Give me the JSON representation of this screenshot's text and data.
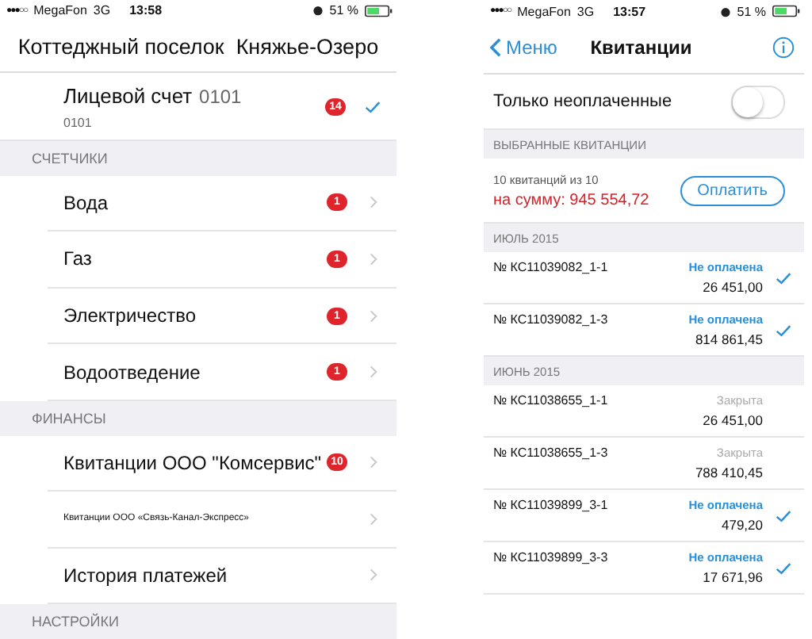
{
  "left_phone": {
    "status_bar": {
      "signal": "●●●○○",
      "carrier": "MegaFon",
      "network": "3G",
      "time": "13:58",
      "battery": "51 %"
    },
    "title": "Коттеджный поселок  Княжье-Озеро",
    "account": {
      "label": "Лицевой счет",
      "number": "0101",
      "subtitle": "0101",
      "badge": "14",
      "checked": true
    },
    "sections": [
      {
        "header": "СЧЕТЧИКИ",
        "items": [
          {
            "label": "Вода",
            "badge": "1",
            "small": false
          },
          {
            "label": "Газ",
            "badge": "1",
            "small": false
          },
          {
            "label": "Электричество",
            "badge": "1",
            "small": false
          },
          {
            "label": "Водоотведение",
            "badge": "1",
            "small": false
          }
        ]
      },
      {
        "header": "ФИНАНСЫ",
        "items": [
          {
            "label": "Квитанции ООО \"Комсервис\"",
            "badge": "10",
            "small": false
          },
          {
            "label": "Квитанции ООО «Связь-Канал-Экспресс»",
            "small": true
          },
          {
            "label": "История платежей",
            "small": false
          }
        ]
      },
      {
        "header": "НАСТРОЙКИ"
      }
    ]
  },
  "right_phone": {
    "status_bar": {
      "signal": "●●●○○",
      "carrier": "MegaFon",
      "network": "3G",
      "time": "13:57",
      "battery": "51 %"
    },
    "back": "Меню",
    "title": "Квитанции",
    "filter": {
      "label": "Только неоплаченные",
      "on": false
    },
    "selected_header": "ВЫБРАННЫЕ КВИТАНЦИИ",
    "summary": {
      "count": "10 квитанций из 10",
      "total": "на сумму: 945 554,72",
      "pay_button": "Оплатить"
    },
    "groups": [
      {
        "header": "ИЮЛЬ 2015",
        "invoices": [
          {
            "number": "№ КС11039082_1-1",
            "status": "Не оплачена",
            "kind": "unpaid",
            "amount": "26 451,00",
            "checked": true
          },
          {
            "number": "№ КС11039082_1-3",
            "status": "Не оплачена",
            "kind": "unpaid",
            "amount": "814 861,45",
            "checked": true
          }
        ]
      },
      {
        "header": "ИЮНЬ 2015",
        "invoices": [
          {
            "number": "№ КС11038655_1-1",
            "status": "Закрыта",
            "kind": "closed",
            "amount": "26 451,00",
            "checked": false
          },
          {
            "number": "№ КС11038655_1-3",
            "status": "Закрыта",
            "kind": "closed",
            "amount": "788 410,45",
            "checked": false
          },
          {
            "number": "№ КС11039899_3-1",
            "status": "Не оплачена",
            "kind": "unpaid",
            "amount": "479,20",
            "checked": true
          },
          {
            "number": "№ КС11039899_3-3",
            "status": "Не оплачена",
            "kind": "unpaid",
            "amount": "17 671,96",
            "checked": true
          }
        ]
      }
    ]
  }
}
